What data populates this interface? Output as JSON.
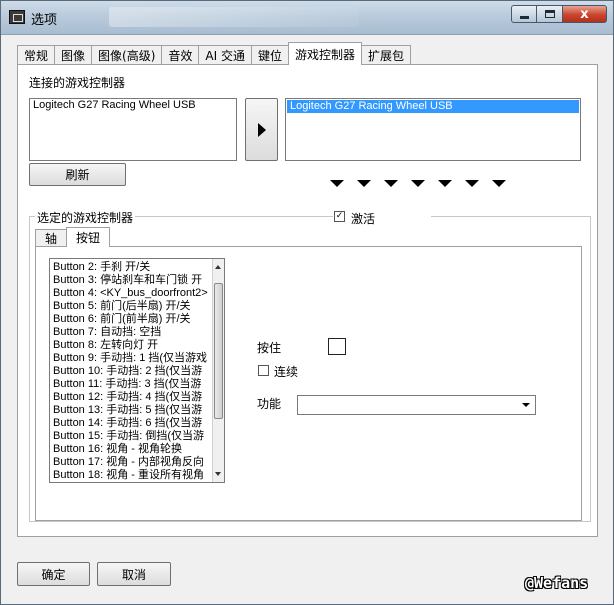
{
  "window": {
    "title": "选项",
    "icons": {
      "app": "app-window-icon",
      "minimize": "minimize-icon",
      "maximize": "maximize-icon",
      "close": "close-icon"
    },
    "close_glyph": "x"
  },
  "tabs": [
    {
      "label": "常规"
    },
    {
      "label": "图像"
    },
    {
      "label": "图像(高级)"
    },
    {
      "label": "音效"
    },
    {
      "label": "AI 交通"
    },
    {
      "label": "键位"
    },
    {
      "label": "游戏控制器",
      "active": true
    },
    {
      "label": "扩展包"
    }
  ],
  "connected": {
    "label": "连接的游戏控制器",
    "available": [
      "Logitech G27 Racing Wheel USB"
    ],
    "selected": [
      "Logitech G27 Racing Wheel USB"
    ],
    "refresh_label": "刷新",
    "transfer_icon": "arrow-right-icon",
    "slot_icon": "triangle-down-icon"
  },
  "selected_group": {
    "title": "选定的游戏控制器",
    "activate_label": "激活",
    "activate_checked": true,
    "check_mark": "☑",
    "subtabs": [
      {
        "label": "轴"
      },
      {
        "label": "按钮",
        "active": true
      }
    ],
    "buttons": [
      "Button 2: 手刹 开/关",
      "Button 3: 停站刹车和车门锁 开",
      "Button 4: <KY_bus_doorfront2>",
      "Button 5: 前门(后半扇) 开/关",
      "Button 6: 前门(前半扇) 开/关",
      "Button 7: 自动挡: 空挡",
      "Button 8: 左转向灯 开",
      "Button 9: 手动挡: 1 挡(仅当游戏",
      "Button 10: 手动挡: 2 挡(仅当游",
      "Button 11: 手动挡: 3 挡(仅当游",
      "Button 12: 手动挡: 4 挡(仅当游",
      "Button 13: 手动挡: 5 挡(仅当游",
      "Button 14: 手动挡: 6 挡(仅当游",
      "Button 15: 手动挡: 倒挡(仅当游",
      "Button 16: 视角 - 视角轮换",
      "Button 17: 视角 - 内部视角反向",
      "Button 18: 视角 - 重设所有视角"
    ],
    "hold_label": "按住",
    "continuous_label": "连续",
    "continuous_checked": false,
    "function_label": "功能",
    "function_value": ""
  },
  "footer": {
    "ok_label": "确定",
    "cancel_label": "取消",
    "watermark": "@Wefans"
  }
}
